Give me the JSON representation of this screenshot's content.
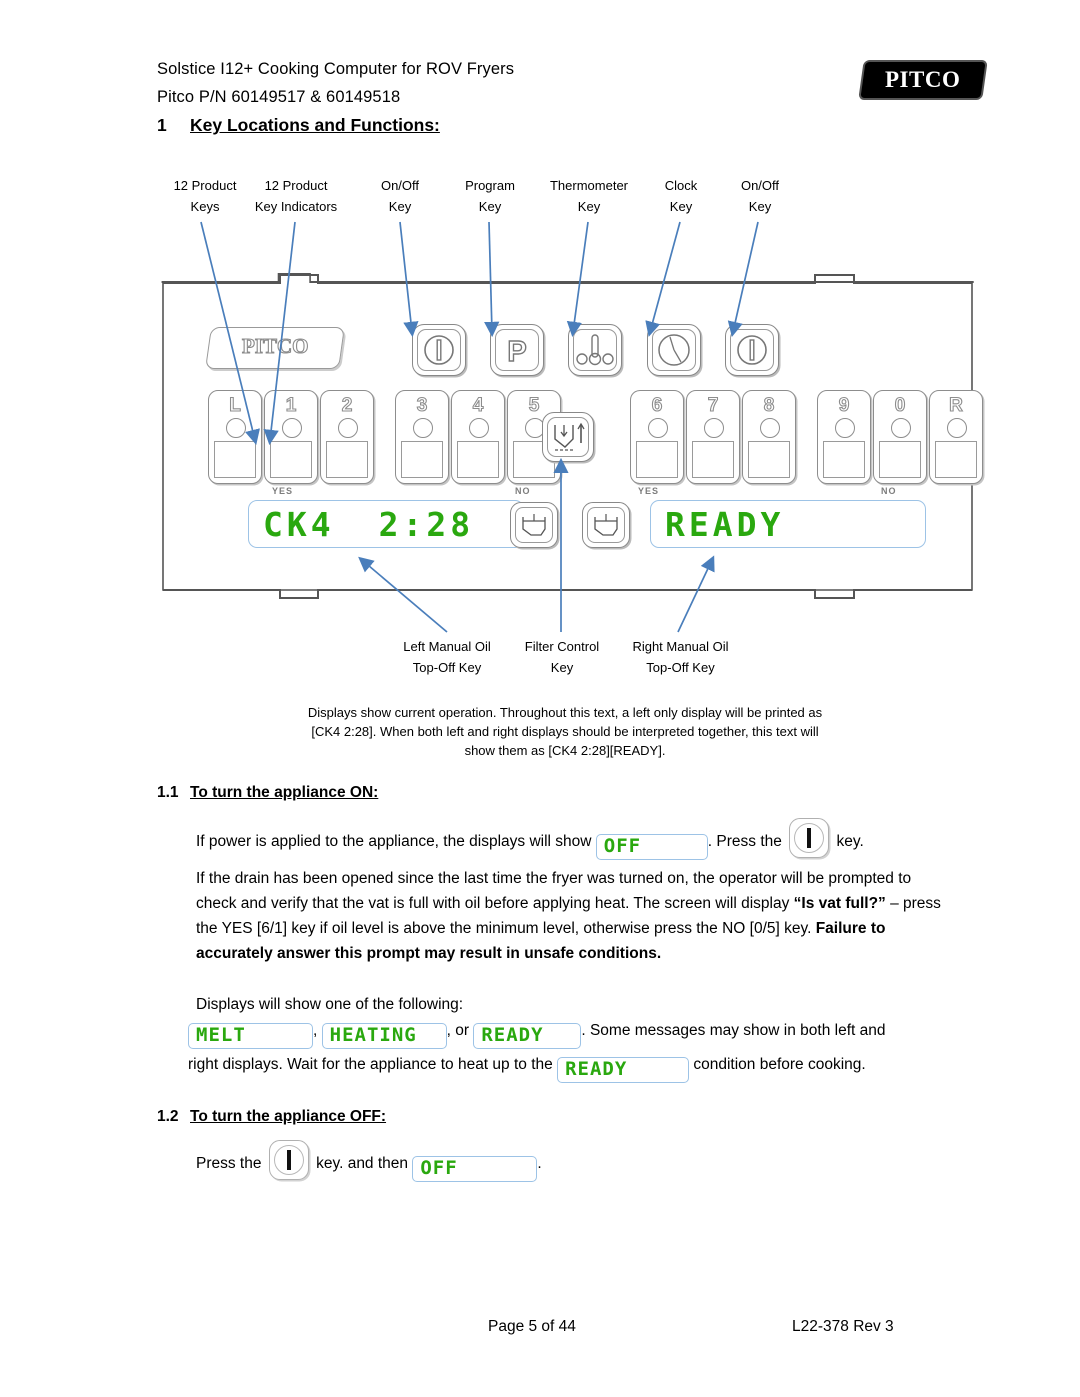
{
  "header": {
    "title": "Solstice I12+ Cooking Computer for ROV Fryers",
    "subtitle": "Pitco P/N 60149517 & 60149518",
    "logo_text": "PITCO"
  },
  "section1": {
    "number": "1",
    "title": "Key Locations and Functions:"
  },
  "callouts_top": [
    {
      "line1": "12 Product",
      "line2": "Keys"
    },
    {
      "line1": "12 Product",
      "line2": "Key Indicators"
    },
    {
      "line1": "On/Off",
      "line2": "Key"
    },
    {
      "line1": "Program",
      "line2": "Key"
    },
    {
      "line1": "Thermometer",
      "line2": "Key"
    },
    {
      "line1": "Clock",
      "line2": "Key"
    },
    {
      "line1": "On/Off",
      "line2": "Key"
    }
  ],
  "callouts_bottom": [
    {
      "line1": "Left Manual Oil",
      "line2": "Top-Off Key"
    },
    {
      "line1": "Filter Control",
      "line2": "Key"
    },
    {
      "line1": "Right Manual Oil",
      "line2": "Top-Off Key"
    }
  ],
  "panel": {
    "logo_text": "PITCO",
    "product_keys_left": [
      "L",
      "1",
      "2",
      "3",
      "4",
      "5"
    ],
    "product_keys_right": [
      "6",
      "7",
      "8",
      "9",
      "0",
      "R"
    ],
    "yes_no_labels": [
      "YES",
      "NO",
      "YES",
      "NO"
    ],
    "display_left": "CK4",
    "display_left_value": "2:28",
    "display_right": "READY",
    "control_keys": [
      "on-off",
      "program",
      "thermometer",
      "clock",
      "on-off"
    ],
    "oil_keys": [
      "left-top-off",
      "filter-control",
      "right-top-off"
    ]
  },
  "note": "Displays show current operation.  Throughout this text, a left only display will be printed as [CK4 2:28].  When both left and right displays should be interpreted together, this text will show them as [CK4 2:28][READY].",
  "section11": {
    "number": "1.1",
    "title": "To turn the appliance ON:",
    "p1_before": "If power is applied to the appliance, the displays will show",
    "p1_lcd": "OFF",
    "p1_mid": ".  Press the",
    "p1_after": "key.",
    "p2_a": "If the drain has been opened since the last time the fryer was turned on, the operator will be prompted to check and verify that the vat is full with oil before applying heat.  The screen will display ",
    "p2_bold1": "“Is vat full?”",
    "p2_b": " – press the YES [6/1] key if oil level is above the minimum level, otherwise press the NO [0/5] key.  ",
    "p2_bold2": "Failure to accurately answer this prompt may result in unsafe conditions.",
    "p3": "Displays will show one of the following:",
    "lcd_melt": "MELT",
    "lcd_heating": "HEATING",
    "lcd_ready": "READY",
    "p4_sep1": ",",
    "p4_sep2": ", or",
    "p4_after": ".  Some messages may show in both left and",
    "p5_before": "right displays.  Wait for the appliance to heat up to the",
    "p5_lcd": "READY",
    "p5_after": "condition before cooking."
  },
  "section12": {
    "number": "1.2",
    "title": "To turn the appliance OFF:",
    "p1_before": "Press the",
    "p1_mid": "key. and then",
    "p1_lcd": "OFF",
    "p1_after": "."
  },
  "footer": {
    "left": "Page 5 of 44",
    "right": "L22-378 Rev 3"
  },
  "colors": {
    "lcd_green": "#2aa80f",
    "lcd_border": "#9dc3e6",
    "arrow_blue": "#4a7ebb"
  }
}
